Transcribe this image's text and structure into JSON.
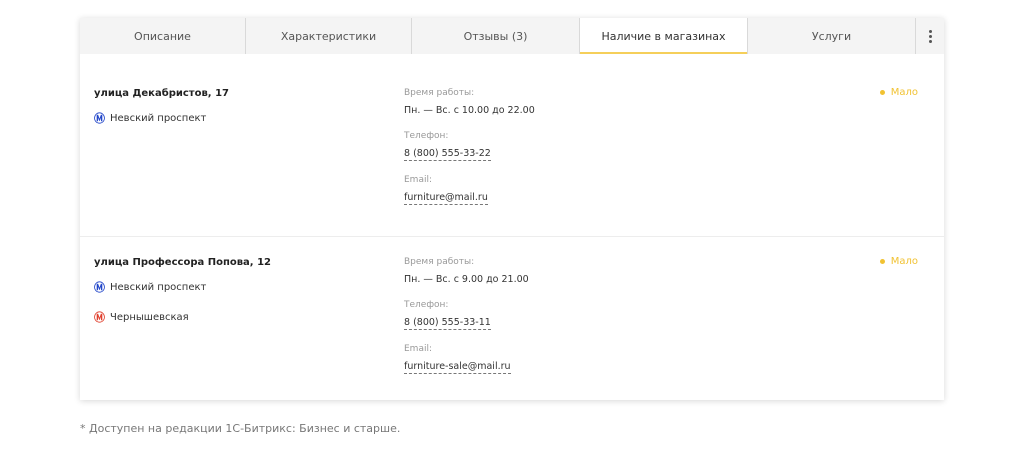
{
  "tabs": [
    {
      "label": "Описание",
      "active": false
    },
    {
      "label": "Характеристики",
      "active": false
    },
    {
      "label": "Отзывы (3)",
      "active": false
    },
    {
      "label": "Наличие в магазинах",
      "active": true
    },
    {
      "label": "Услуги",
      "active": false
    }
  ],
  "labels": {
    "hours": "Время работы:",
    "phone": "Телефон:",
    "email": "Email:"
  },
  "stores": [
    {
      "address": "улица Декабристов, 17",
      "metro": [
        {
          "icon": "metro-icon",
          "line_color": "#2246c9",
          "name": "Невский проспект"
        }
      ],
      "hours": "Пн. — Вс. с 10.00 до 22.00",
      "phone": "8 (800) 555-33-22",
      "email": "furniture@mail.ru",
      "stock": "Мало"
    },
    {
      "address": "улица Профессора Попова, 12",
      "metro": [
        {
          "icon": "metro-icon",
          "line_color": "#2246c9",
          "name": "Невский проспект"
        },
        {
          "icon": "metro-icon",
          "line_color": "#e0402e",
          "name": "Чернышевская"
        }
      ],
      "hours": "Пн. — Вс. с 9.00 до 21.00",
      "phone": "8 (800) 555-33-11",
      "email": "furniture-sale@mail.ru",
      "stock": "Мало"
    }
  ],
  "colors": {
    "stock_low": "#f1c232",
    "active_tab_underline": "#f5cf5a"
  },
  "footnote": "* Доступен на редакции 1С-Битрикс: Бизнес и старше."
}
